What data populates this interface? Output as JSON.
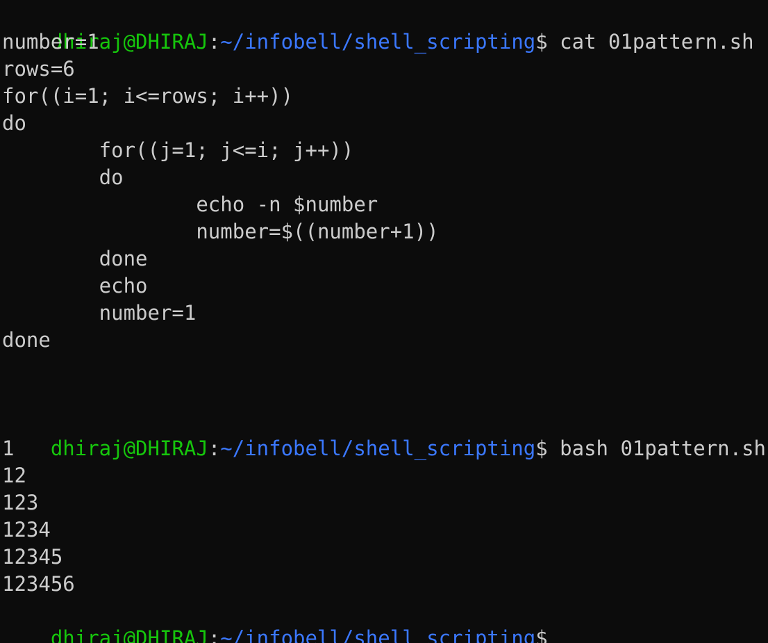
{
  "terminal": {
    "prompt": {
      "user_host": "dhiraj@DHIRAJ",
      "colon": ":",
      "path": "~/infobell/shell_scripting",
      "dollar": "$"
    },
    "commands": {
      "cat": " cat 01pattern.sh",
      "bash": " bash 01pattern.sh"
    },
    "script_lines": [
      "number=1",
      "rows=6",
      "for((i=1; i<=rows; i++))",
      "do",
      "        for((j=1; j<=i; j++))",
      "        do",
      "                echo -n $number",
      "                number=$((number+1))",
      "        done",
      "        echo",
      "        number=1",
      "done"
    ],
    "output_lines": [
      "1",
      "12",
      "123",
      "1234",
      "12345",
      "123456"
    ],
    "colors": {
      "background": "#0c0c0c",
      "foreground": "#cccccc",
      "user_host": "#16c60c",
      "path": "#3b78ff"
    }
  }
}
